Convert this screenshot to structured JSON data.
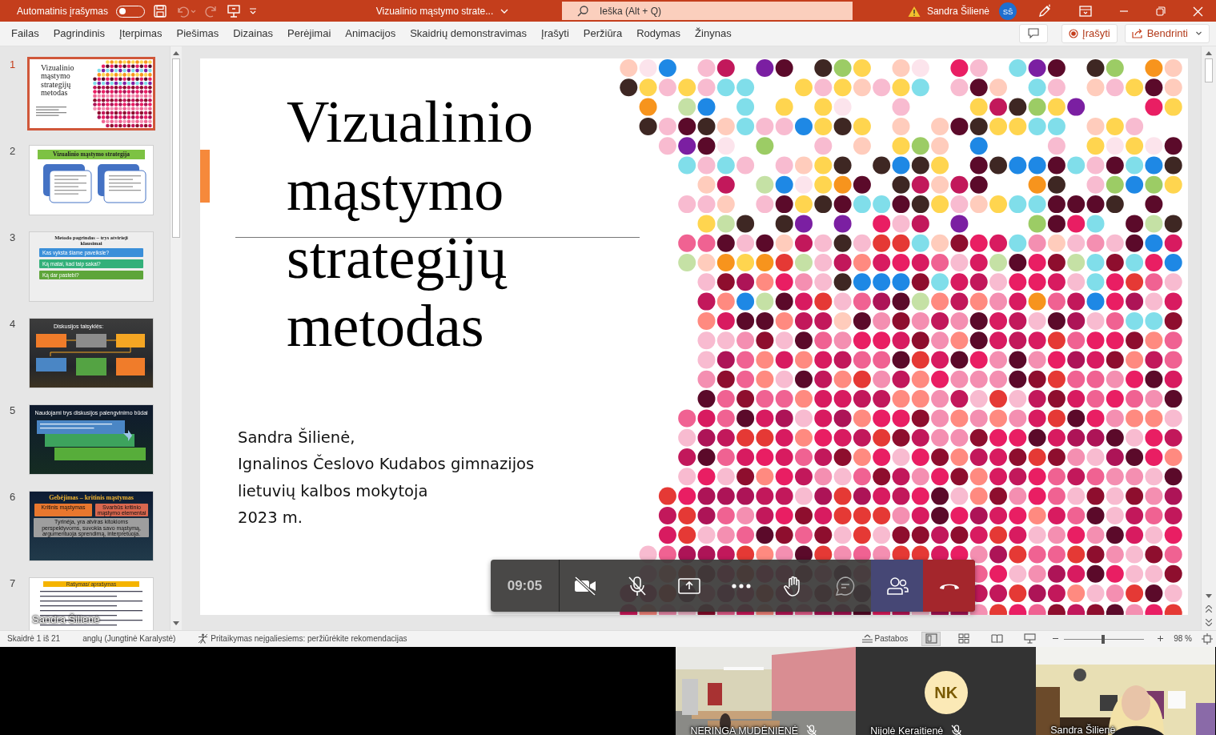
{
  "title_bar": {
    "autosave_label": "Automatinis įrašymas",
    "autosave_on": false,
    "undo_disabled": true,
    "redo_disabled": true,
    "document_title": "Vizualinio mąstymo strate...",
    "search": {
      "placeholder": "Ieška (Alt + Q)"
    },
    "user_name": "Sandra Šilienė",
    "avatar_initials": "SŠ"
  },
  "ribbon": {
    "tabs": [
      {
        "label": "Failas",
        "selected": false
      },
      {
        "label": "Pagrindinis",
        "selected": false
      },
      {
        "label": "Įterpimas",
        "selected": false
      },
      {
        "label": "Piešimas",
        "selected": false
      },
      {
        "label": "Dizainas",
        "selected": false
      },
      {
        "label": "Perėjimai",
        "selected": false
      },
      {
        "label": "Animacijos",
        "selected": false
      },
      {
        "label": "Skaidrių demonstravimas",
        "selected": false
      },
      {
        "label": "Įrašyti",
        "selected": false
      },
      {
        "label": "Peržiūra",
        "selected": false
      },
      {
        "label": "Rodymas",
        "selected": false
      },
      {
        "label": "Žinynas",
        "selected": false
      }
    ],
    "record_button": "Įrašyti",
    "share_button": "Bendrinti"
  },
  "slides": [
    {
      "number": "1",
      "selected": true,
      "kind": "title",
      "title": "Vizualinio mąstymo strategijų metodas"
    },
    {
      "number": "2",
      "selected": false,
      "kind": "banner",
      "title": "Vizualinio mąstymo strategija"
    },
    {
      "number": "3",
      "selected": false,
      "kind": "questions",
      "title": "Metodo pagrindas – trys atvirieji klausimai",
      "items": [
        {
          "text": "Kas vyksta šiame paveiksle?",
          "color": "#3b8fd9"
        },
        {
          "text": "Ką matai, kad taip sakai?",
          "color": "#33b07a"
        },
        {
          "text": "Ką dar pastebi?",
          "color": "#5ea53a"
        }
      ]
    },
    {
      "number": "4",
      "selected": false,
      "kind": "flow",
      "title": "Diskusijos taisyklės:"
    },
    {
      "number": "5",
      "selected": false,
      "kind": "steps",
      "title": "Naudojami trys diskusijos palengvinimo būdai"
    },
    {
      "number": "6",
      "selected": false,
      "kind": "critical",
      "title": "Gebėjimas – kritinis mąstymas",
      "items": [
        {
          "text": "Kritinis mąstymas",
          "color": "#e8772e"
        },
        {
          "text": "Svarbūs kritinio mąstymo elementai",
          "color": "#d9674f"
        },
        {
          "text": "Tyrinėja, yra atviras kitokioms perspektyvoms, suvokia savo mąstymą, argumentuoja sprendimą, interpretuoja.",
          "color": "#9e9e9e"
        }
      ]
    },
    {
      "number": "7",
      "selected": false,
      "kind": "text",
      "title": "Rašymas/ aprašymas"
    }
  ],
  "thumbnail_overlay_name": "Sandra Šilienė",
  "slide": {
    "title_lines": [
      "Vizualinio",
      "mąstymo",
      "strategijų",
      "metodas"
    ],
    "author_lines": [
      "Sandra Šilienė,",
      "Ignalinos Česlovo Kudabos gimnazijos",
      "lietuvių kalbos mokytoja",
      "2023 m."
    ]
  },
  "call_controls": {
    "timer": "09:05",
    "camera_on": false,
    "mic_on": false
  },
  "status_bar": {
    "slide_counter": "Skaidrė 1 iš 21",
    "language": "anglų (Jungtinė Karalystė)",
    "accessibility": "Pritaikymas neįgaliesiems: peržiūrėkite rekomendacijas",
    "notes": "Pastabos",
    "views": [
      {
        "kind": "normal",
        "selected": true
      },
      {
        "kind": "sorter",
        "selected": false
      },
      {
        "kind": "reading",
        "selected": false
      },
      {
        "kind": "show",
        "selected": false
      }
    ],
    "zoom": {
      "level": 0.49,
      "reading": "98 %"
    }
  },
  "participants": [
    {
      "kind": "picture",
      "name": "NERINGA MUDĖNIENĖ",
      "muted": true
    },
    {
      "kind": "avatar",
      "initials": "NK",
      "name": "Nijolė Keraitienė",
      "muted": true
    },
    {
      "kind": "picture",
      "name": "Sandra Šilienė",
      "muted": false
    }
  ]
}
